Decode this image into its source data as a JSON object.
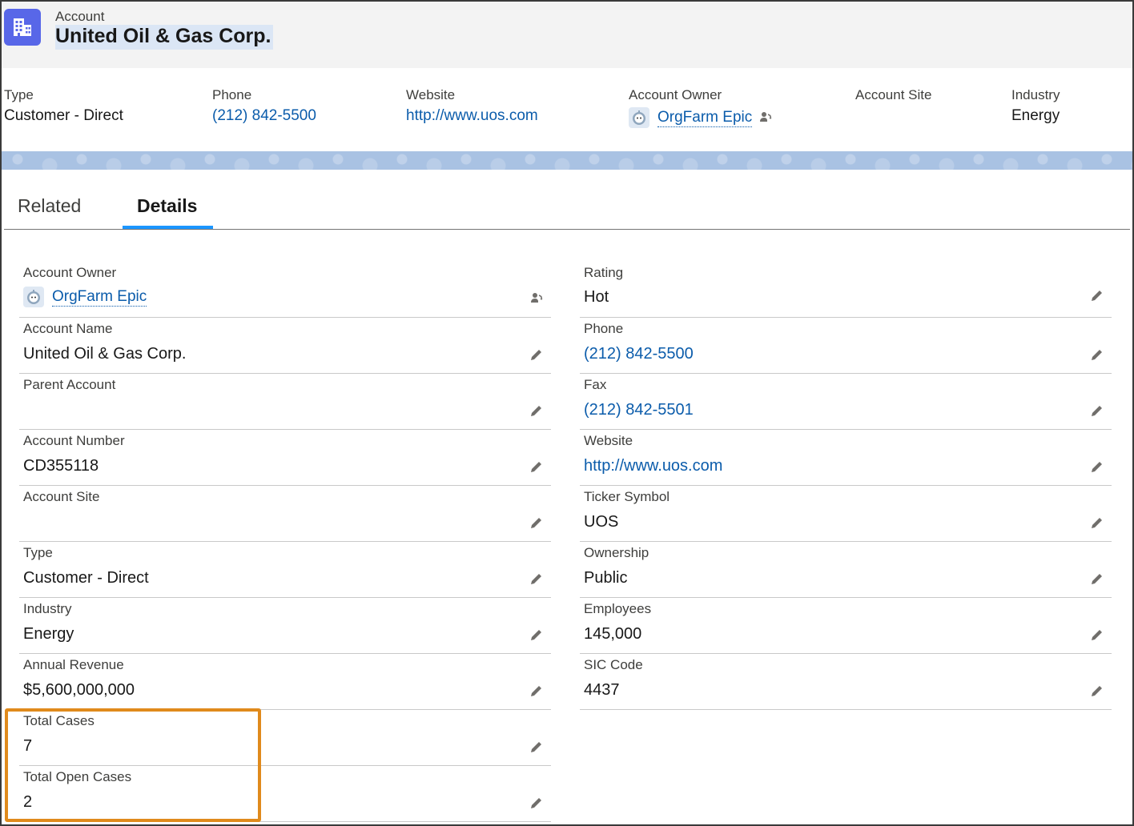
{
  "header": {
    "object_label": "Account",
    "title": "United Oil & Gas Corp.",
    "icon": "account-building-icon"
  },
  "highlights": {
    "type": {
      "label": "Type",
      "value": "Customer - Direct"
    },
    "phone": {
      "label": "Phone",
      "value": "(212) 842-5500"
    },
    "website": {
      "label": "Website",
      "value": "http://www.uos.com"
    },
    "owner": {
      "label": "Account Owner",
      "value": "OrgFarm Epic"
    },
    "site": {
      "label": "Account Site",
      "value": ""
    },
    "industry": {
      "label": "Industry",
      "value": "Energy"
    }
  },
  "tabs": [
    {
      "label": "Related",
      "active": false
    },
    {
      "label": "Details",
      "active": true
    }
  ],
  "details": {
    "left": [
      {
        "label": "Account Owner",
        "value": "OrgFarm Epic"
      },
      {
        "label": "Account Name",
        "value": "United Oil & Gas Corp."
      },
      {
        "label": "Parent Account",
        "value": ""
      },
      {
        "label": "Account Number",
        "value": "CD355118"
      },
      {
        "label": "Account Site",
        "value": ""
      },
      {
        "label": "Type",
        "value": "Customer - Direct"
      },
      {
        "label": "Industry",
        "value": "Energy"
      },
      {
        "label": "Annual Revenue",
        "value": "$5,600,000,000"
      },
      {
        "label": "Total Cases",
        "value": "7"
      },
      {
        "label": "Total Open Cases",
        "value": "2"
      }
    ],
    "right": [
      {
        "label": "Rating",
        "value": "Hot"
      },
      {
        "label": "Phone",
        "value": "(212) 842-5500"
      },
      {
        "label": "Fax",
        "value": "(212) 842-5501"
      },
      {
        "label": "Website",
        "value": "http://www.uos.com"
      },
      {
        "label": "Ticker Symbol",
        "value": "UOS"
      },
      {
        "label": "Ownership",
        "value": "Public"
      },
      {
        "label": "Employees",
        "value": "145,000"
      },
      {
        "label": "SIC Code",
        "value": "4437"
      }
    ]
  },
  "colors": {
    "brand_icon": "#5867e8",
    "link": "#0b5cab",
    "tab_active": "#1b96ff",
    "annotation_box": "#e08a1c"
  }
}
